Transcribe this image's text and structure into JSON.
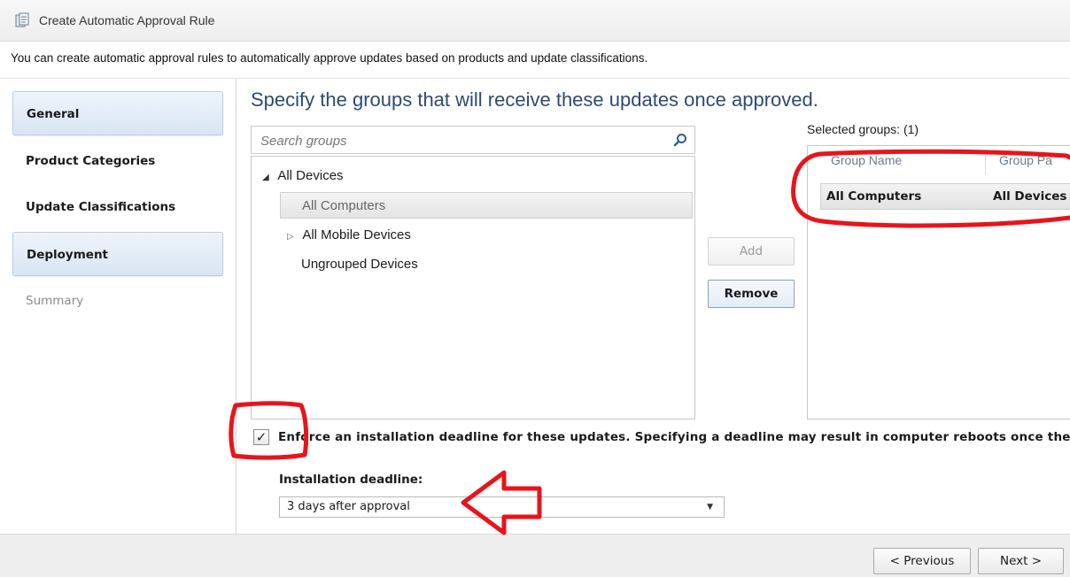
{
  "window": {
    "title": "Create Automatic Approval Rule",
    "icon": "wizard-icon"
  },
  "description": "You can create automatic approval rules to automatically approve updates based on products and update classifications.",
  "nav": {
    "items": [
      {
        "label": "General",
        "state": "active"
      },
      {
        "label": "Product Categories",
        "state": "normal"
      },
      {
        "label": "Update Classifications",
        "state": "normal"
      },
      {
        "label": "Deployment",
        "state": "active"
      },
      {
        "label": "Summary",
        "state": "muted"
      }
    ]
  },
  "main": {
    "heading": "Specify the groups that will receive these updates once approved.",
    "search": {
      "placeholder": "Search groups",
      "value": "",
      "icon": "search-icon"
    },
    "tree": [
      {
        "label": "All Devices",
        "toggle": "expanded"
      },
      {
        "label": "All Computers",
        "toggle": "none",
        "selected": true
      },
      {
        "label": "All Mobile Devices",
        "toggle": "collapsed"
      },
      {
        "label": "Ungrouped Devices",
        "toggle": "none"
      }
    ],
    "buttons": {
      "add": "Add",
      "remove": "Remove"
    },
    "selected_groups": {
      "label": "Selected groups: (1)",
      "columns": [
        "Group Name",
        "Group Pa"
      ],
      "rows": [
        [
          "All Computers",
          "All Devices"
        ]
      ]
    },
    "deadline": {
      "checked": true,
      "check_glyph": "✓",
      "checkbox_text": "Enforce an installation deadline for these updates. Specifying a deadline may result in computer reboots once the d",
      "install_label": "Installation deadline:",
      "select_value": "3 days after approval"
    }
  },
  "footer": {
    "previous": "< Previous",
    "next": "Next >"
  },
  "colors": {
    "annotation_red": "#e8141b",
    "heading_blue": "#2b4b75",
    "nav_active": "#d9e5f3"
  }
}
